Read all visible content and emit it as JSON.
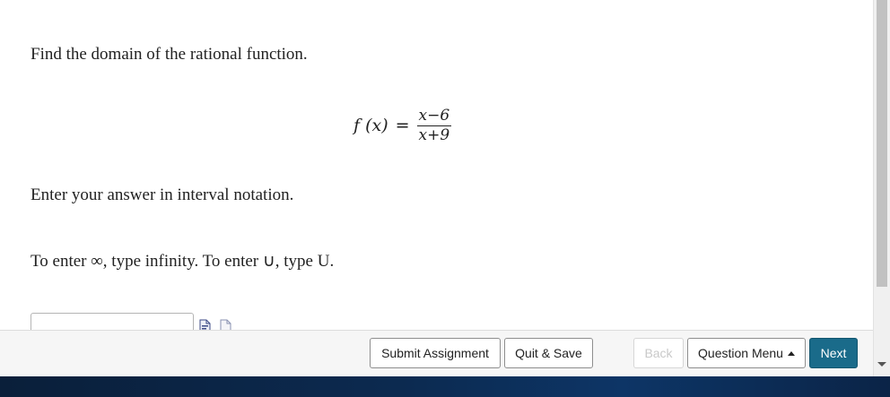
{
  "question": {
    "prompt": "Find the domain of the rational function.",
    "function_lhs": "f (x)",
    "equals": "=",
    "numerator": "x−6",
    "denominator": "x+9",
    "instruction": "Enter your answer in interval notation.",
    "hint": "To enter ∞, type infinity. To enter ∪, type U."
  },
  "answer": {
    "value": "",
    "placeholder": ""
  },
  "icons": {
    "preview": "preview-document-icon",
    "help": "document-icon"
  },
  "footer": {
    "submit_label": "Submit Assignment",
    "quit_label": "Quit & Save",
    "back_label": "Back",
    "menu_label": "Question Menu",
    "next_label": "Next"
  },
  "colors": {
    "primary": "#1a6b8a",
    "taskbar": "#0c2a50"
  }
}
